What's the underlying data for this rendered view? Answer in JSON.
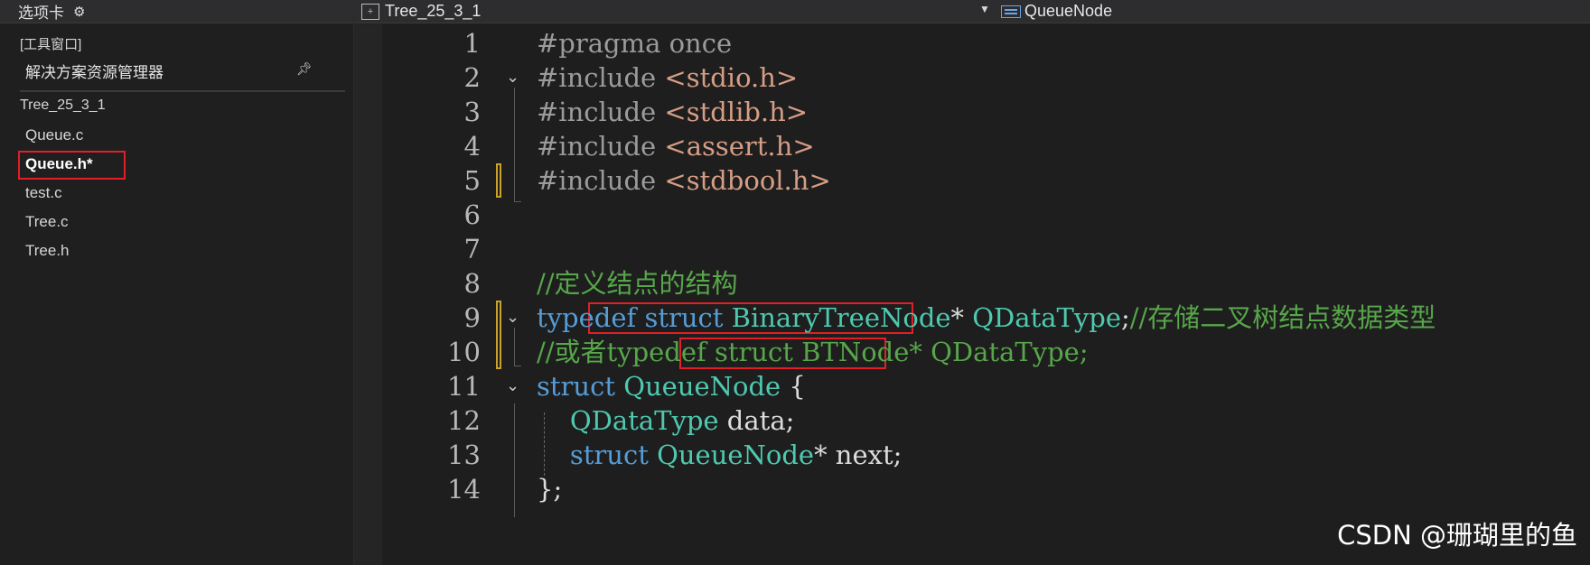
{
  "left_panel": {
    "tab_label": "选项卡",
    "tool_window_tag": "[工具窗口]",
    "title": "解决方案资源管理器",
    "pin_icon": "pin-icon",
    "project_name": "Tree_25_3_1",
    "files": [
      "Queue.c",
      "Queue.h*",
      "test.c",
      "Tree.c",
      "Tree.h"
    ],
    "active_file_index": 1
  },
  "editor_bar": {
    "file_scope": "Tree_25_3_1",
    "member_scope": "QueueNode"
  },
  "code_lines": [
    {
      "n": "1",
      "parts": [
        {
          "t": "#pragma once",
          "c": "kw-pre"
        }
      ]
    },
    {
      "n": "2",
      "parts": [
        {
          "t": "#include ",
          "c": "kw-pre"
        },
        {
          "t": "<stdio.h>",
          "c": "str"
        }
      ]
    },
    {
      "n": "3",
      "parts": [
        {
          "t": "#include ",
          "c": "kw-pre"
        },
        {
          "t": "<stdlib.h>",
          "c": "str"
        }
      ]
    },
    {
      "n": "4",
      "parts": [
        {
          "t": "#include ",
          "c": "kw-pre"
        },
        {
          "t": "<assert.h>",
          "c": "str"
        }
      ]
    },
    {
      "n": "5",
      "parts": [
        {
          "t": "#include ",
          "c": "kw-pre"
        },
        {
          "t": "<stdbool.h>",
          "c": "str"
        }
      ]
    },
    {
      "n": "6",
      "parts": []
    },
    {
      "n": "7",
      "parts": []
    },
    {
      "n": "8",
      "parts": [
        {
          "t": "//定义结点的结构",
          "c": "cmt"
        }
      ]
    },
    {
      "n": "9",
      "parts": [
        {
          "t": "typedef ",
          "c": "kw"
        },
        {
          "t": "struct ",
          "c": "kw"
        },
        {
          "t": "BinaryTreeNode",
          "c": "type"
        },
        {
          "t": "* ",
          "c": "plain"
        },
        {
          "t": "QDataType",
          "c": "type"
        },
        {
          "t": ";",
          "c": "plain"
        },
        {
          "t": "//存储二叉树结点数据类型",
          "c": "cmt"
        }
      ]
    },
    {
      "n": "10",
      "parts": [
        {
          "t": "//或者typedef struct BTNode* QDataType;",
          "c": "cmt"
        }
      ]
    },
    {
      "n": "11",
      "parts": [
        {
          "t": "struct ",
          "c": "kw"
        },
        {
          "t": "QueueNode",
          "c": "type"
        },
        {
          "t": " {",
          "c": "plain"
        }
      ]
    },
    {
      "n": "12",
      "parts": [
        {
          "t": "    ",
          "c": "plain"
        },
        {
          "t": "QDataType",
          "c": "type"
        },
        {
          "t": " data;",
          "c": "ident"
        }
      ]
    },
    {
      "n": "13",
      "parts": [
        {
          "t": "    ",
          "c": "plain"
        },
        {
          "t": "struct ",
          "c": "kw"
        },
        {
          "t": "QueueNode",
          "c": "type"
        },
        {
          "t": "* next;",
          "c": "ident"
        }
      ]
    },
    {
      "n": "14",
      "parts": [
        {
          "t": "};",
          "c": "plain"
        }
      ]
    }
  ],
  "watermark": "CSDN @珊瑚里的鱼"
}
